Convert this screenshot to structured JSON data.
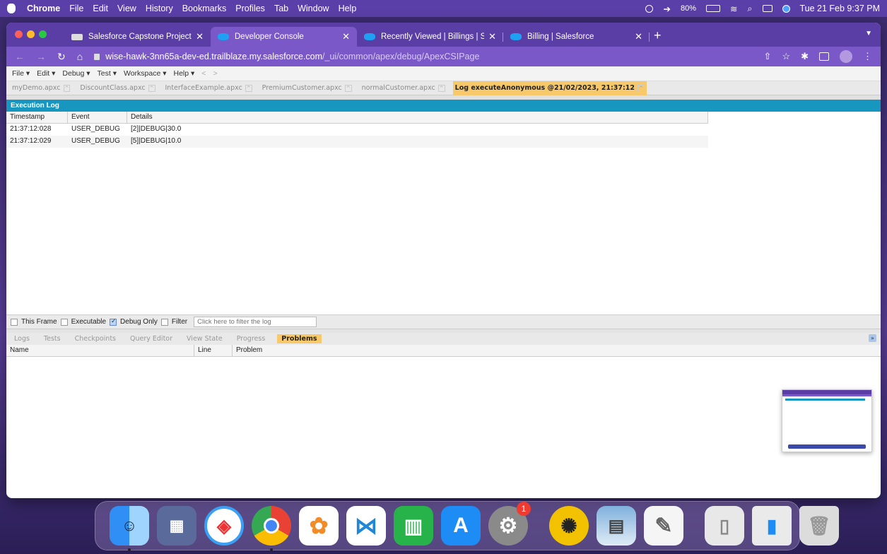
{
  "menubar": {
    "app": "Chrome",
    "items": [
      "File",
      "Edit",
      "View",
      "History",
      "Bookmarks",
      "Profiles",
      "Tab",
      "Window",
      "Help"
    ],
    "battery": "80%",
    "clock": "Tue 21 Feb  9:37 PM"
  },
  "browser": {
    "tabs": [
      {
        "title": "Salesforce Capstone Project -",
        "active": false
      },
      {
        "title": "Developer Console",
        "active": true
      },
      {
        "title": "Recently Viewed | Billings | Sal",
        "active": false
      },
      {
        "title": "Billing | Salesforce",
        "active": false
      }
    ],
    "new_tab": "+",
    "url_host": "wise-hawk-3nn65a-dev-ed.trailblaze.my.salesforce.com",
    "url_path": "/_ui/common/apex/debug/ApexCSIPage"
  },
  "console": {
    "menu": [
      "File ▾",
      "Edit ▾",
      "Debug ▾",
      "Test ▾",
      "Workspace ▾",
      "Help ▾",
      "<",
      ">"
    ],
    "file_tabs": [
      {
        "label": "myDemo.apxc",
        "active": false
      },
      {
        "label": "DiscountClass.apxc",
        "active": false
      },
      {
        "label": "InterfaceExample.apxc",
        "active": false
      },
      {
        "label": "PremiumCustomer.apxc",
        "active": false
      },
      {
        "label": "normalCustomer.apxc",
        "active": false
      },
      {
        "label": "Log executeAnonymous @21/02/2023, 21:37:12",
        "active": true
      }
    ],
    "execution_log": {
      "title": "Execution Log",
      "columns": [
        "Timestamp",
        "Event",
        "Details"
      ],
      "rows": [
        {
          "timestamp": "21:37:12:028",
          "event": "USER_DEBUG",
          "details": "[2]|DEBUG|30.0"
        },
        {
          "timestamp": "21:37:12:029",
          "event": "USER_DEBUG",
          "details": "[5]|DEBUG|10.0"
        }
      ]
    },
    "filters": {
      "this_frame": {
        "label": "This Frame",
        "checked": false
      },
      "executable": {
        "label": "Executable",
        "checked": false
      },
      "debug_only": {
        "label": "Debug Only",
        "checked": true
      },
      "filter": {
        "label": "Filter",
        "checked": false
      },
      "placeholder": "Click here to filter the log"
    },
    "bottom_tabs": [
      {
        "label": "Logs",
        "active": false
      },
      {
        "label": "Tests",
        "active": false
      },
      {
        "label": "Checkpoints",
        "active": false
      },
      {
        "label": "Query Editor",
        "active": false
      },
      {
        "label": "View State",
        "active": false
      },
      {
        "label": "Progress",
        "active": false
      },
      {
        "label": "Problems",
        "active": true
      }
    ],
    "problems": {
      "columns": [
        "Name",
        "Line",
        "Problem"
      ]
    }
  },
  "dock": {
    "apps": [
      {
        "name": "finder-icon",
        "color": "#2f8ff5",
        "glyph": ""
      },
      {
        "name": "launchpad-icon",
        "color": "#5a6a9a",
        "glyph": ""
      },
      {
        "name": "safari-icon",
        "color": "#3aa0f5",
        "glyph": ""
      },
      {
        "name": "chrome-icon",
        "color": "#ffffff",
        "glyph": ""
      },
      {
        "name": "photos-icon",
        "color": "#ffffff",
        "glyph": ""
      },
      {
        "name": "vscode-icon",
        "color": "#ffffff",
        "glyph": ""
      },
      {
        "name": "numbers-icon",
        "color": "#27b34a",
        "glyph": ""
      },
      {
        "name": "app-store-icon",
        "color": "#1d8cf5",
        "glyph": ""
      },
      {
        "name": "system-settings-icon",
        "color": "#8a8a8a",
        "glyph": "",
        "badge": "1"
      },
      {
        "name": "cpu-app-icon",
        "color": "#f2c200",
        "glyph": ""
      },
      {
        "name": "preview-icon",
        "color": "#a9c4e0",
        "glyph": ""
      },
      {
        "name": "textedit-icon",
        "color": "#f5f5f5",
        "glyph": ""
      },
      {
        "name": "documents-icon",
        "color": "#e8e8e8",
        "glyph": ""
      },
      {
        "name": "trash-icon",
        "color": "#dcdcdc",
        "glyph": ""
      }
    ]
  }
}
